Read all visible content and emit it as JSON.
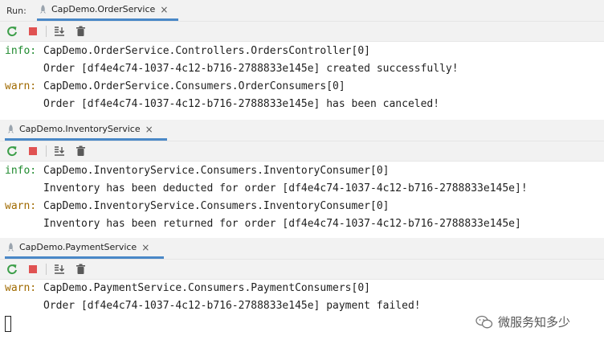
{
  "run_label": "Run:",
  "panels": [
    {
      "tab_title": "CapDemo.OrderService",
      "lines": [
        {
          "level": "info:",
          "text": "CapDemo.OrderService.Controllers.OrdersController[0]"
        },
        {
          "level": "",
          "text": "Order [df4e4c74-1037-4c12-b716-2788833e145e] created successfully!"
        },
        {
          "level": "warn:",
          "text": "CapDemo.OrderService.Consumers.OrderConsumers[0]"
        },
        {
          "level": "",
          "text": "Order [df4e4c74-1037-4c12-b716-2788833e145e] has been canceled!"
        }
      ]
    },
    {
      "tab_title": "CapDemo.InventoryService",
      "lines": [
        {
          "level": "info:",
          "text": "CapDemo.InventoryService.Consumers.InventoryConsumer[0]"
        },
        {
          "level": "",
          "text": "Inventory has been deducted for order [df4e4c74-1037-4c12-b716-2788833e145e]!"
        },
        {
          "level": "warn:",
          "text": "CapDemo.InventoryService.Consumers.InventoryConsumer[0]"
        },
        {
          "level": "",
          "text": "Inventory has been returned for order [df4e4c74-1037-4c12-b716-2788833e145e]"
        }
      ]
    },
    {
      "tab_title": "CapDemo.PaymentService",
      "lines": [
        {
          "level": "warn:",
          "text": "CapDemo.PaymentService.Consumers.PaymentConsumers[0]"
        },
        {
          "level": "",
          "text": "Order [df4e4c74-1037-4c12-b716-2788833e145e] payment failed!"
        }
      ]
    }
  ],
  "tab_close_glyph": "×",
  "icons": [
    "rerun-icon",
    "stop-icon",
    "scroll-to-end-icon",
    "clear-trash-icon",
    "rocket-icon",
    "wechat-icon"
  ],
  "colors": {
    "info": "#1f8a2e",
    "warn": "#a06a00",
    "tab_underline": "#4a88c7",
    "stop": "#e05252",
    "rerun": "#3d9f4a"
  },
  "watermark": "微服务知多少"
}
